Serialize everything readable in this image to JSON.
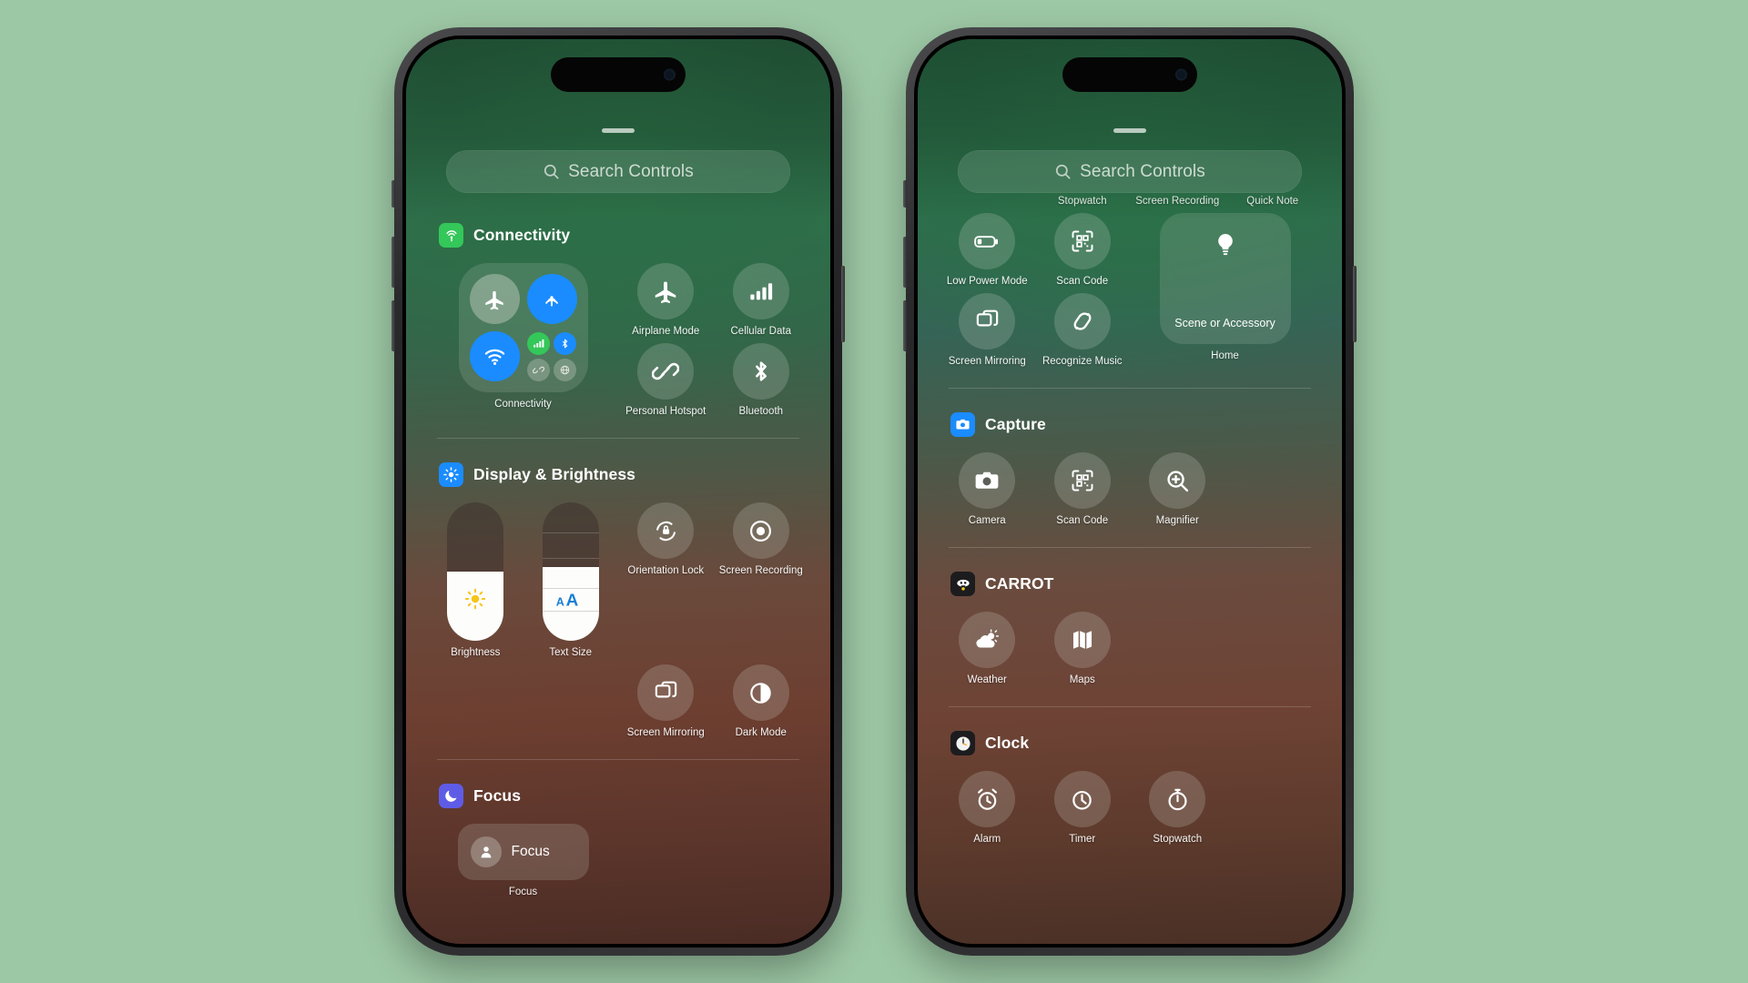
{
  "background_color": "#9dc8a5",
  "accent_colors": {
    "blue": "#1a8cff",
    "green": "#34c759",
    "white": "#ffffff",
    "yellow": "#ffcc00",
    "purple": "#5e5ce6"
  },
  "phones": [
    {
      "id": "left-phone",
      "search": {
        "placeholder": "Search Controls",
        "icon": "search-icon"
      },
      "groups": [
        {
          "id": "connectivity",
          "title": "Connectivity",
          "icon": "connectivity-icon",
          "icon_color": "#34c759",
          "controls": [
            {
              "label": "Connectivity",
              "type": "module-2x2",
              "icon": "connectivity-module-icon",
              "sub": [
                {
                  "label": "Airplane Mode",
                  "icon": "airplane-icon",
                  "state": "off"
                },
                {
                  "label": "AirDrop",
                  "icon": "airdrop-icon",
                  "state": "on"
                },
                {
                  "label": "Wi-Fi",
                  "icon": "wifi-icon",
                  "state": "on"
                },
                {
                  "label": "Cellular Data",
                  "icon": "cellular-icon",
                  "state": "on"
                },
                {
                  "label": "Bluetooth",
                  "icon": "bluetooth-icon",
                  "state": "on"
                },
                {
                  "label": "Personal Hotspot",
                  "icon": "hotspot-icon",
                  "state": "off"
                },
                {
                  "label": "VPN",
                  "icon": "vpn-icon",
                  "state": "off"
                }
              ]
            },
            {
              "label": "Airplane Mode",
              "type": "round",
              "icon": "airplane-icon"
            },
            {
              "label": "Cellular Data",
              "type": "round",
              "icon": "cellular-icon"
            },
            {
              "label": "Personal Hotspot",
              "type": "round",
              "icon": "hotspot-icon"
            },
            {
              "label": "Bluetooth",
              "type": "round",
              "icon": "bluetooth-icon"
            }
          ]
        },
        {
          "id": "display-brightness",
          "title": "Display & Brightness",
          "icon": "brightness-icon",
          "icon_color": "#1a8cff",
          "controls": [
            {
              "label": "Brightness",
              "type": "slider",
              "icon": "sun-icon",
              "value": 50
            },
            {
              "label": "Text Size",
              "type": "slider",
              "icon": "text-size-icon",
              "value": 47
            },
            {
              "label": "Orientation Lock",
              "type": "round",
              "icon": "orientation-lock-icon"
            },
            {
              "label": "Screen Recording",
              "type": "round",
              "icon": "screen-recording-icon"
            },
            {
              "label": "Screen Mirroring",
              "type": "round",
              "icon": "screen-mirroring-icon"
            },
            {
              "label": "Dark Mode",
              "type": "round",
              "icon": "dark-mode-icon"
            }
          ]
        },
        {
          "id": "focus",
          "title": "Focus",
          "icon": "focus-moon-icon",
          "icon_color": "#5e5ce6",
          "controls": [
            {
              "label": "Focus",
              "type": "pill",
              "icon": "focus-person-icon",
              "pill_text": "Focus"
            }
          ]
        }
      ]
    },
    {
      "id": "right-phone",
      "search": {
        "placeholder": "Search Controls",
        "icon": "search-icon"
      },
      "clipped_labels": [
        "Stopwatch",
        "Screen Recording",
        "Quick Note"
      ],
      "groups": [
        {
          "id": "home-group",
          "title": "",
          "icon": "",
          "icon_color": "",
          "controls": [
            {
              "label": "Low Power Mode",
              "type": "round",
              "icon": "low-power-icon"
            },
            {
              "label": "Scan Code",
              "type": "round",
              "icon": "scan-code-icon"
            },
            {
              "label": "Home",
              "type": "wide",
              "icon": "lightbulb-icon",
              "tile_text": "Scene or Accessory"
            },
            {
              "label": "Screen Mirroring",
              "type": "round",
              "icon": "screen-mirroring-icon"
            },
            {
              "label": "Recognize Music",
              "type": "round",
              "icon": "shazam-icon"
            }
          ]
        },
        {
          "id": "capture",
          "title": "Capture",
          "icon": "camera-icon",
          "icon_color": "#1a8cff",
          "controls": [
            {
              "label": "Camera",
              "type": "round",
              "icon": "camera-icon"
            },
            {
              "label": "Scan Code",
              "type": "round",
              "icon": "scan-code-icon"
            },
            {
              "label": "Magnifier",
              "type": "round",
              "icon": "magnifier-icon"
            }
          ]
        },
        {
          "id": "carrot",
          "title": "CARROT",
          "icon": "carrot-robot-icon",
          "icon_color": "#1c1c1e",
          "controls": [
            {
              "label": "Weather",
              "type": "round",
              "icon": "weather-icon"
            },
            {
              "label": "Maps",
              "type": "round",
              "icon": "maps-icon"
            }
          ]
        },
        {
          "id": "clock",
          "title": "Clock",
          "icon": "clock-icon",
          "icon_color": "#1c1c1e",
          "controls": [
            {
              "label": "Alarm",
              "type": "round",
              "icon": "alarm-icon"
            },
            {
              "label": "Timer",
              "type": "round",
              "icon": "timer-icon"
            },
            {
              "label": "Stopwatch",
              "type": "round",
              "icon": "stopwatch-icon"
            }
          ]
        }
      ]
    }
  ]
}
